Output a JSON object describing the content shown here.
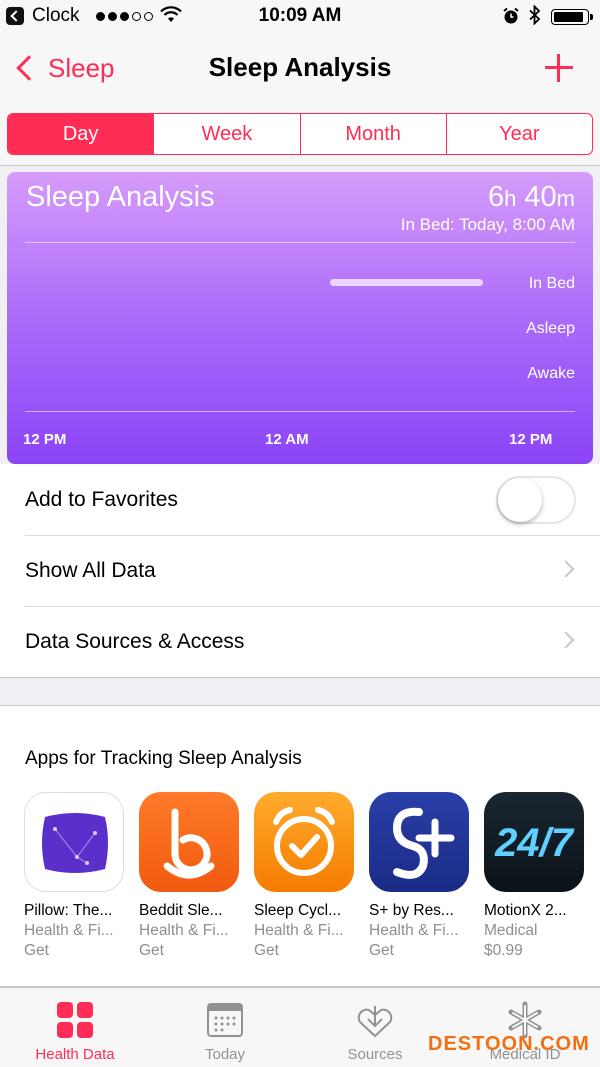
{
  "status_bar": {
    "back_app": "Clock",
    "time": "10:09 AM"
  },
  "nav": {
    "back_label": "Sleep",
    "title": "Sleep Analysis"
  },
  "segments": [
    {
      "label": "Day",
      "active": true
    },
    {
      "label": "Week",
      "active": false
    },
    {
      "label": "Month",
      "active": false
    },
    {
      "label": "Year",
      "active": false
    }
  ],
  "chart": {
    "title": "Sleep Analysis",
    "duration_hours": "6",
    "duration_hours_unit": "h",
    "duration_minutes": "40",
    "duration_minutes_unit": "m",
    "subtitle": "In Bed: Today, 8:00 AM",
    "colors": {
      "top": "#d59bfa",
      "bottom": "#8b44f7"
    }
  },
  "chart_data": {
    "type": "bar",
    "title": "Sleep Analysis",
    "categories": [
      "In Bed",
      "Asleep",
      "Awake"
    ],
    "x_ticks": [
      "12 PM",
      "12 AM",
      "12 PM"
    ],
    "series": [
      {
        "category": "In Bed",
        "start_hours_from_noon": 13.3,
        "end_hours_from_noon": 20.0
      }
    ],
    "grid": true
  },
  "list": {
    "favorites": "Add to Favorites",
    "favorites_on": false,
    "show_all": "Show All Data",
    "sources": "Data Sources & Access"
  },
  "apps": {
    "title": "Apps for Tracking Sleep Analysis",
    "items": [
      {
        "name": "Pillow: The...",
        "category": "Health & Fi...",
        "price": "Get",
        "icon": "pillow-icon"
      },
      {
        "name": "Beddit Sle...",
        "category": "Health & Fi...",
        "price": "Get",
        "icon": "beddit-icon"
      },
      {
        "name": "Sleep Cycl...",
        "category": "Health & Fi...",
        "price": "Get",
        "icon": "sleep-cycle-icon"
      },
      {
        "name": "S+ by Res...",
        "category": "Health & Fi...",
        "price": "Get",
        "icon": "splus-icon"
      },
      {
        "name": "MotionX 2...",
        "category": "Medical",
        "price": "$0.99",
        "icon": "motionx-icon"
      }
    ]
  },
  "tabs": [
    {
      "label": "Health Data",
      "active": true,
      "icon": "health-data-icon"
    },
    {
      "label": "Today",
      "active": false,
      "icon": "calendar-icon"
    },
    {
      "label": "Sources",
      "active": false,
      "icon": "sources-icon"
    },
    {
      "label": "Medical ID",
      "active": false,
      "icon": "medical-id-icon"
    }
  ],
  "watermark": "DESTOON.COM",
  "accent": "#ff2d55"
}
